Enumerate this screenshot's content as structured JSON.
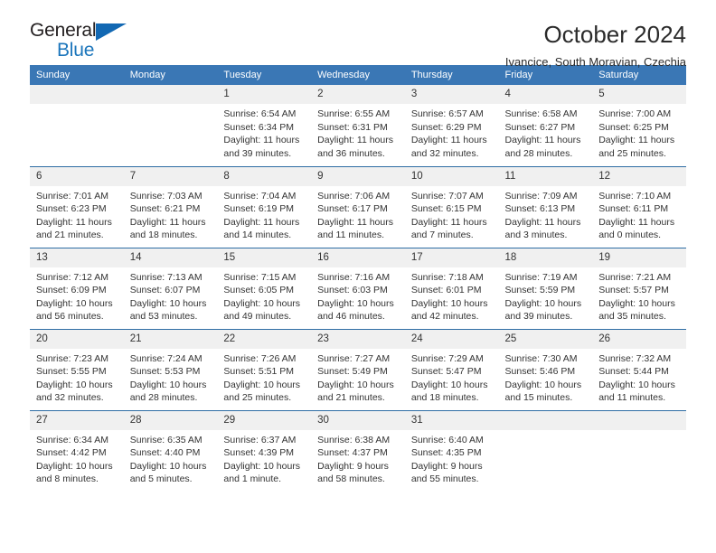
{
  "brand": {
    "name_part1": "General",
    "name_part2": "Blue",
    "accent_color": "#1b75bb"
  },
  "header": {
    "title": "October 2024",
    "subtitle": "Ivancice, South Moravian, Czechia"
  },
  "theme": {
    "header_row_bg": "#3a77b5",
    "week_divider": "#2e6da4",
    "daynum_bg": "#f0f0f0"
  },
  "weekdays": [
    "Sunday",
    "Monday",
    "Tuesday",
    "Wednesday",
    "Thursday",
    "Friday",
    "Saturday"
  ],
  "weeks": [
    [
      {
        "day": "",
        "lines": []
      },
      {
        "day": "",
        "lines": []
      },
      {
        "day": "1",
        "lines": [
          "Sunrise: 6:54 AM",
          "Sunset: 6:34 PM",
          "Daylight: 11 hours and 39 minutes."
        ]
      },
      {
        "day": "2",
        "lines": [
          "Sunrise: 6:55 AM",
          "Sunset: 6:31 PM",
          "Daylight: 11 hours and 36 minutes."
        ]
      },
      {
        "day": "3",
        "lines": [
          "Sunrise: 6:57 AM",
          "Sunset: 6:29 PM",
          "Daylight: 11 hours and 32 minutes."
        ]
      },
      {
        "day": "4",
        "lines": [
          "Sunrise: 6:58 AM",
          "Sunset: 6:27 PM",
          "Daylight: 11 hours and 28 minutes."
        ]
      },
      {
        "day": "5",
        "lines": [
          "Sunrise: 7:00 AM",
          "Sunset: 6:25 PM",
          "Daylight: 11 hours and 25 minutes."
        ]
      }
    ],
    [
      {
        "day": "6",
        "lines": [
          "Sunrise: 7:01 AM",
          "Sunset: 6:23 PM",
          "Daylight: 11 hours and 21 minutes."
        ]
      },
      {
        "day": "7",
        "lines": [
          "Sunrise: 7:03 AM",
          "Sunset: 6:21 PM",
          "Daylight: 11 hours and 18 minutes."
        ]
      },
      {
        "day": "8",
        "lines": [
          "Sunrise: 7:04 AM",
          "Sunset: 6:19 PM",
          "Daylight: 11 hours and 14 minutes."
        ]
      },
      {
        "day": "9",
        "lines": [
          "Sunrise: 7:06 AM",
          "Sunset: 6:17 PM",
          "Daylight: 11 hours and 11 minutes."
        ]
      },
      {
        "day": "10",
        "lines": [
          "Sunrise: 7:07 AM",
          "Sunset: 6:15 PM",
          "Daylight: 11 hours and 7 minutes."
        ]
      },
      {
        "day": "11",
        "lines": [
          "Sunrise: 7:09 AM",
          "Sunset: 6:13 PM",
          "Daylight: 11 hours and 3 minutes."
        ]
      },
      {
        "day": "12",
        "lines": [
          "Sunrise: 7:10 AM",
          "Sunset: 6:11 PM",
          "Daylight: 11 hours and 0 minutes."
        ]
      }
    ],
    [
      {
        "day": "13",
        "lines": [
          "Sunrise: 7:12 AM",
          "Sunset: 6:09 PM",
          "Daylight: 10 hours and 56 minutes."
        ]
      },
      {
        "day": "14",
        "lines": [
          "Sunrise: 7:13 AM",
          "Sunset: 6:07 PM",
          "Daylight: 10 hours and 53 minutes."
        ]
      },
      {
        "day": "15",
        "lines": [
          "Sunrise: 7:15 AM",
          "Sunset: 6:05 PM",
          "Daylight: 10 hours and 49 minutes."
        ]
      },
      {
        "day": "16",
        "lines": [
          "Sunrise: 7:16 AM",
          "Sunset: 6:03 PM",
          "Daylight: 10 hours and 46 minutes."
        ]
      },
      {
        "day": "17",
        "lines": [
          "Sunrise: 7:18 AM",
          "Sunset: 6:01 PM",
          "Daylight: 10 hours and 42 minutes."
        ]
      },
      {
        "day": "18",
        "lines": [
          "Sunrise: 7:19 AM",
          "Sunset: 5:59 PM",
          "Daylight: 10 hours and 39 minutes."
        ]
      },
      {
        "day": "19",
        "lines": [
          "Sunrise: 7:21 AM",
          "Sunset: 5:57 PM",
          "Daylight: 10 hours and 35 minutes."
        ]
      }
    ],
    [
      {
        "day": "20",
        "lines": [
          "Sunrise: 7:23 AM",
          "Sunset: 5:55 PM",
          "Daylight: 10 hours and 32 minutes."
        ]
      },
      {
        "day": "21",
        "lines": [
          "Sunrise: 7:24 AM",
          "Sunset: 5:53 PM",
          "Daylight: 10 hours and 28 minutes."
        ]
      },
      {
        "day": "22",
        "lines": [
          "Sunrise: 7:26 AM",
          "Sunset: 5:51 PM",
          "Daylight: 10 hours and 25 minutes."
        ]
      },
      {
        "day": "23",
        "lines": [
          "Sunrise: 7:27 AM",
          "Sunset: 5:49 PM",
          "Daylight: 10 hours and 21 minutes."
        ]
      },
      {
        "day": "24",
        "lines": [
          "Sunrise: 7:29 AM",
          "Sunset: 5:47 PM",
          "Daylight: 10 hours and 18 minutes."
        ]
      },
      {
        "day": "25",
        "lines": [
          "Sunrise: 7:30 AM",
          "Sunset: 5:46 PM",
          "Daylight: 10 hours and 15 minutes."
        ]
      },
      {
        "day": "26",
        "lines": [
          "Sunrise: 7:32 AM",
          "Sunset: 5:44 PM",
          "Daylight: 10 hours and 11 minutes."
        ]
      }
    ],
    [
      {
        "day": "27",
        "lines": [
          "Sunrise: 6:34 AM",
          "Sunset: 4:42 PM",
          "Daylight: 10 hours and 8 minutes."
        ]
      },
      {
        "day": "28",
        "lines": [
          "Sunrise: 6:35 AM",
          "Sunset: 4:40 PM",
          "Daylight: 10 hours and 5 minutes."
        ]
      },
      {
        "day": "29",
        "lines": [
          "Sunrise: 6:37 AM",
          "Sunset: 4:39 PM",
          "Daylight: 10 hours and 1 minute."
        ]
      },
      {
        "day": "30",
        "lines": [
          "Sunrise: 6:38 AM",
          "Sunset: 4:37 PM",
          "Daylight: 9 hours and 58 minutes."
        ]
      },
      {
        "day": "31",
        "lines": [
          "Sunrise: 6:40 AM",
          "Sunset: 4:35 PM",
          "Daylight: 9 hours and 55 minutes."
        ]
      },
      {
        "day": "",
        "lines": []
      },
      {
        "day": "",
        "lines": []
      }
    ]
  ]
}
